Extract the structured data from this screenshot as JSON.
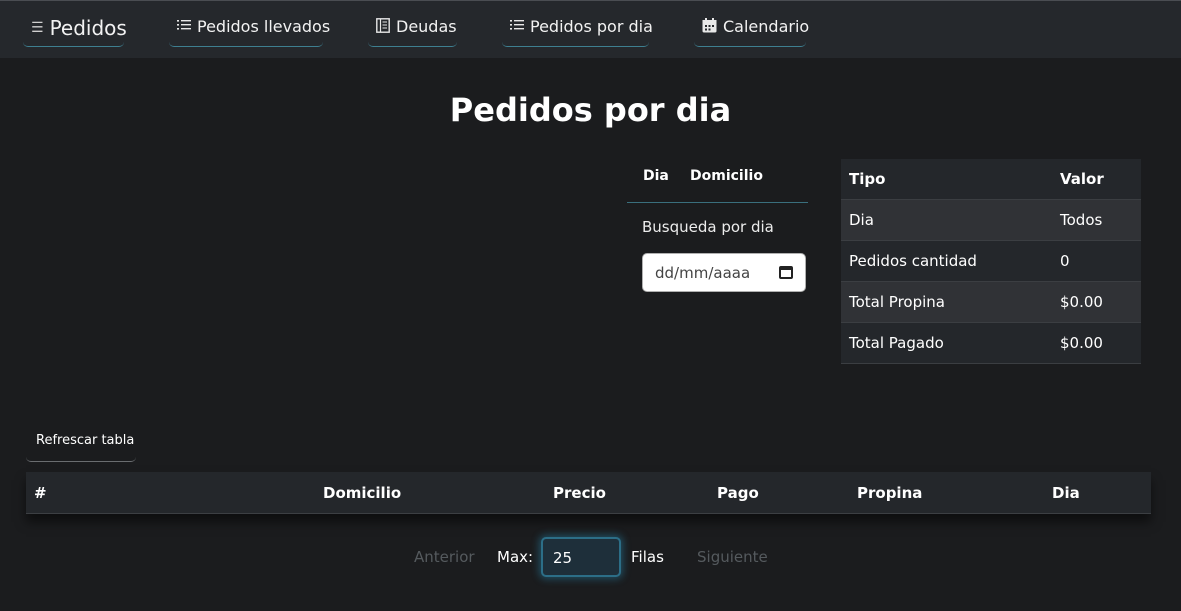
{
  "navbar": {
    "brand": "Pedidos",
    "items": [
      {
        "label": "Pedidos llevados",
        "icon": "list-icon"
      },
      {
        "label": "Deudas",
        "icon": "ledger-icon"
      },
      {
        "label": "Pedidos por dia",
        "icon": "list-icon"
      },
      {
        "label": "Calendario",
        "icon": "calendar-icon"
      }
    ]
  },
  "page": {
    "title": "Pedidos por dia"
  },
  "filters": {
    "tabs": [
      "Dia",
      "Domicilio"
    ],
    "search_label": "Busqueda por dia",
    "date_placeholder": "dd/mm/aaaa"
  },
  "summary": {
    "headers": [
      "Tipo",
      "Valor"
    ],
    "rows": [
      [
        "Dia",
        "Todos"
      ],
      [
        "Pedidos cantidad",
        "0"
      ],
      [
        "Total Propina",
        "$0.00"
      ],
      [
        "Total Pagado",
        "$0.00"
      ]
    ]
  },
  "table": {
    "refresh_label": "Refrescar tabla",
    "columns": [
      "#",
      "Domicilio",
      "Precio",
      "Pago",
      "Propina",
      "Dia"
    ]
  },
  "pagination": {
    "prev_label": "Anterior",
    "max_label": "Max:",
    "rows_value": "25",
    "rows_label": "Filas",
    "next_label": "Siguiente"
  },
  "colors": {
    "background": "#1b1c1e",
    "navbar": "#25282c",
    "accent": "#3e7f90"
  }
}
